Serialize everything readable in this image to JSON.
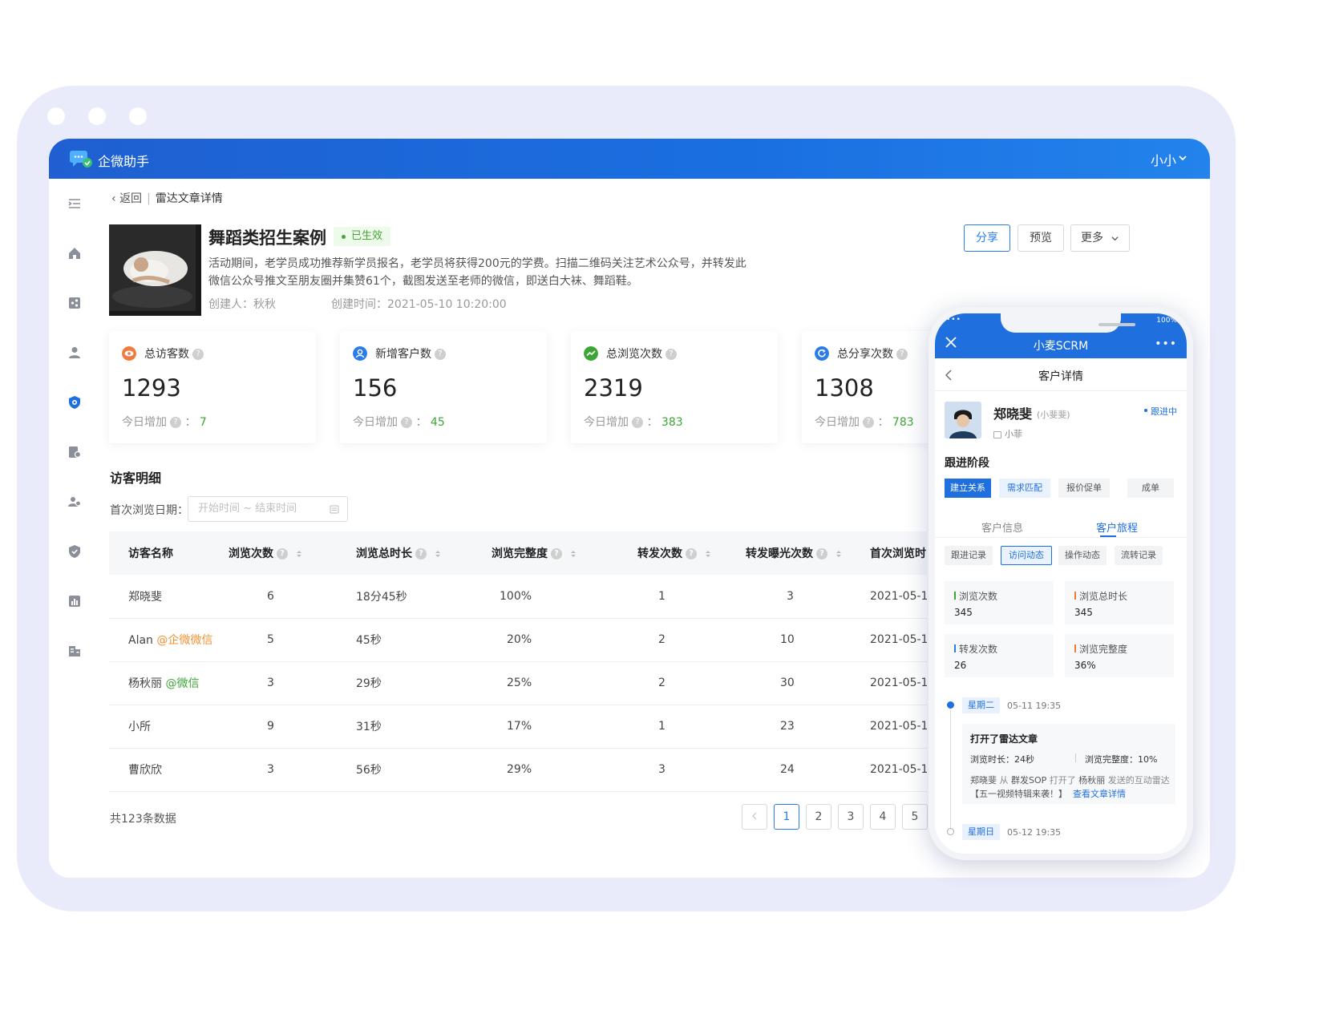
{
  "app": {
    "title": "企微助手",
    "user": "小小"
  },
  "breadcrumb": {
    "back": "返回",
    "current": "雷达文章详情"
  },
  "article": {
    "title": "舞蹈类招生案例",
    "status": "已生效",
    "description": "活动期间，老学员成功推荐新学员报名，老学员将获得200元的学费。扫描二维码关注艺术公众号，并转发此微信公众号推文至朋友圈并集赞61个，截图发送至老师的微信，即送白大袜、舞蹈鞋。",
    "creator": "创建人：秋秋",
    "created_at": "创建时间：2021-05-10 10:20:00"
  },
  "actions": {
    "share": "分享",
    "preview": "预览",
    "more": "更多"
  },
  "stats": [
    {
      "label": "总访客数",
      "value": "1293",
      "today_label": "今日增加",
      "today": "7",
      "color": "#f07b3f"
    },
    {
      "label": "新增客户数",
      "value": "156",
      "today_label": "今日增加",
      "today": "45",
      "color": "#2a7ce8"
    },
    {
      "label": "总浏览次数",
      "value": "2319",
      "today_label": "今日增加",
      "today": "383",
      "color": "#3ba635"
    },
    {
      "label": "总分享次数",
      "value": "1308",
      "today_label": "今日增加",
      "today": "783",
      "color": "#2a7ce8"
    }
  ],
  "visitors": {
    "section_title": "访客明细",
    "date_label": "首次浏览日期：",
    "date_placeholder": "开始时间 ~ 结束时间",
    "columns": [
      "访客名称",
      "浏览次数",
      "浏览总时长",
      "浏览完整度",
      "转发次数",
      "转发曝光次数",
      "首次浏览时间"
    ],
    "rows": [
      {
        "name": "郑晓斐",
        "tag": "",
        "views": "6",
        "duration": "18分45秒",
        "completion": "100%",
        "forwards": "1",
        "exposure": "3",
        "first": "2021-05-12"
      },
      {
        "name": "Alan",
        "tag": "@企微微信",
        "views": "5",
        "duration": "45秒",
        "completion": "20%",
        "forwards": "2",
        "exposure": "10",
        "first": "2021-05-12"
      },
      {
        "name": "杨秋丽",
        "tag": "@微信",
        "views": "3",
        "duration": "29秒",
        "completion": "25%",
        "forwards": "2",
        "exposure": "30",
        "first": "2021-05-12"
      },
      {
        "name": "小所",
        "tag": "",
        "views": "9",
        "duration": "31秒",
        "completion": "17%",
        "forwards": "1",
        "exposure": "23",
        "first": "2021-05-12"
      },
      {
        "name": "曹欣欣",
        "tag": "",
        "views": "3",
        "duration": "56秒",
        "completion": "29%",
        "forwards": "3",
        "exposure": "24",
        "first": "2021-05-12"
      }
    ],
    "total": "共123条数据",
    "pages": [
      "1",
      "2",
      "3",
      "4",
      "5"
    ],
    "current_page": "1"
  },
  "phone": {
    "status_left": "•••",
    "battery": "100%",
    "app_title": "小麦SCRM",
    "more": "•••",
    "page_title": "客户详情",
    "customer": {
      "name": "郑晓斐",
      "alias": "(小斐斐)",
      "status": "跟进中",
      "owner": "小菲"
    },
    "stage_title": "跟进阶段",
    "stages": [
      "建立关系",
      "需求匹配",
      "报价促单",
      "成单"
    ],
    "tabs": [
      "客户信息",
      "客户旅程"
    ],
    "chips": [
      "跟进记录",
      "访问动态",
      "操作动态",
      "流转记录"
    ],
    "metrics": [
      {
        "label": "浏览次数",
        "value": "345",
        "color": "#3ba635"
      },
      {
        "label": "浏览总时长",
        "value": "345",
        "color": "#f07b3f"
      },
      {
        "label": "转发次数",
        "value": "26",
        "color": "#2a7ce8"
      },
      {
        "label": "浏览完整度",
        "value": "36%",
        "color": "#f07b3f"
      }
    ],
    "timeline": [
      {
        "day": "星期二",
        "time": "05-11  19:35"
      },
      {
        "day": "星期日",
        "time": "05-12  19:35"
      }
    ],
    "event": {
      "title": "打开了雷达文章",
      "duration": "浏览时长：24秒",
      "completion": "浏览完整度：10%",
      "desc_person": "郑晓斐",
      "desc_from": "从",
      "desc_source": "群发SOP",
      "desc_open": "打开了",
      "desc_sender": "杨秋丽",
      "desc_sent": "发送的互动雷达",
      "desc_article": "【五一视频特辑来袭！】",
      "link": "查看文章详情"
    }
  }
}
